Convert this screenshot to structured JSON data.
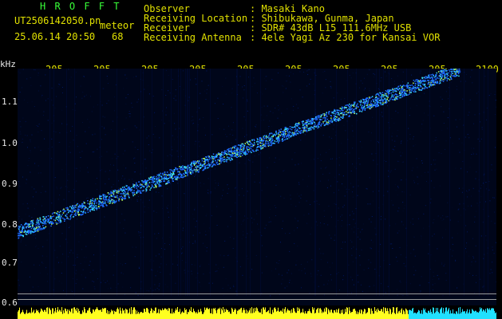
{
  "header": {
    "app_title": "H R O F F T",
    "filename": "UT2506142050.pn",
    "suffix": "meteor",
    "datetime": "25.06.14 20:50",
    "count": "68",
    "fields": [
      {
        "label": "Observer",
        "value": ": Masaki Kano"
      },
      {
        "label": "Receiving Location",
        "value": ": Shibukawa, Gunma, Japan"
      },
      {
        "label": "Receiver",
        "value": ": SDR# 43dB L15 111.6MHz USB"
      },
      {
        "label": "Receiving Antenna",
        "value": ": 4ele Yagi Az 230 for Kansai VOR"
      }
    ]
  },
  "axis": {
    "y_unit": "kHz",
    "y_ticks": [
      "1.1",
      "1.0",
      "0.9",
      "0.8",
      "0.7",
      "0.6"
    ],
    "x_ticks": [
      "205",
      "205",
      "205",
      "205",
      "205",
      "205",
      "205",
      "205",
      "205",
      "2100"
    ]
  },
  "colors": {
    "green_text": "#38ff38",
    "yellow_text": "#e0e000",
    "trace_blue": "#1e6cff",
    "trace_cyan": "#38e0ff",
    "level_yellow": "#ffff20",
    "level_cyan": "#20e0ff"
  },
  "signal": {
    "type": "spectrogram",
    "freq_start_khz": 0.78,
    "freq_end_khz": 1.18
  }
}
